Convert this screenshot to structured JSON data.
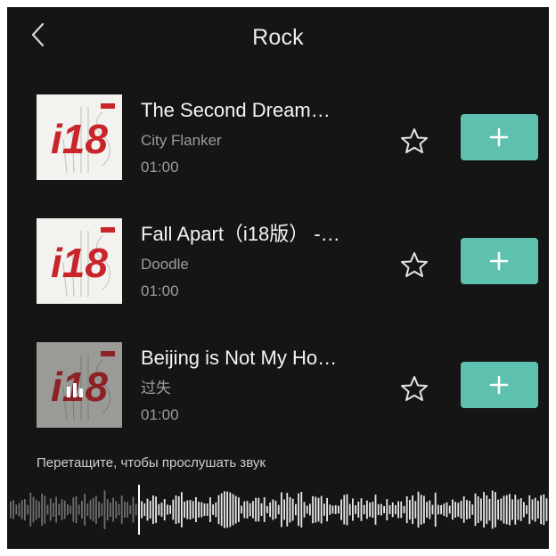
{
  "header": {
    "back_icon": "chevron-left-icon",
    "title": "Rock"
  },
  "tracks": [
    {
      "title": "The Second Dream…",
      "artist": "City Flanker",
      "duration": "01:00",
      "cover_text": "i18",
      "favorite_icon": "star-outline-icon",
      "add_icon": "plus-icon"
    },
    {
      "title": "Fall Apart（i18版） -…",
      "artist": "Doodle",
      "duration": "01:00",
      "cover_text": "i18",
      "favorite_icon": "star-outline-icon",
      "add_icon": "plus-icon"
    },
    {
      "title": "Beijing is Not My Ho…",
      "artist": "过失",
      "duration": "01:00",
      "cover_text": "i18",
      "favorite_icon": "star-outline-icon",
      "add_icon": "plus-icon"
    }
  ],
  "preview": {
    "hint": "Перетащите, чтобы прослушать звук"
  },
  "colors": {
    "background": "#151515",
    "accent": "#5ec1af",
    "text_primary": "#f4f4f4",
    "text_secondary": "#9c9c9c",
    "cover_red": "#c8242a"
  }
}
